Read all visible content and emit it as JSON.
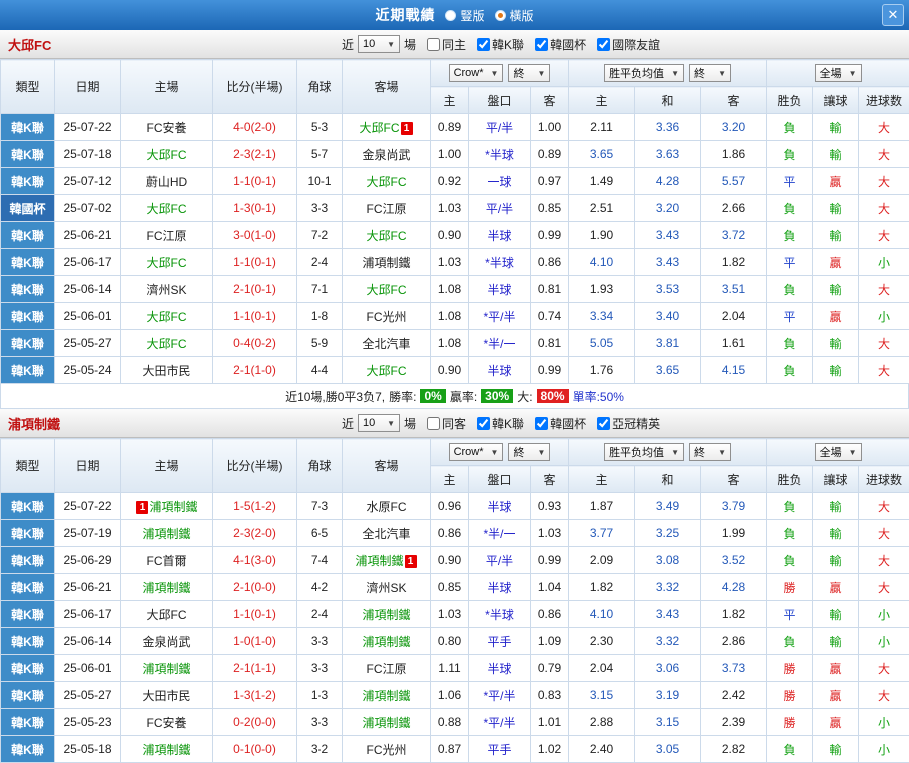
{
  "titlebar": {
    "title": "近期戰績",
    "radios": [
      {
        "label": "豎版",
        "selected": false
      },
      {
        "label": "橫版",
        "selected": true
      }
    ],
    "close_label": "✕"
  },
  "table_header": {
    "left_columns": [
      "類型",
      "日期",
      "主場",
      "比分(半場)",
      "角球",
      "客場"
    ],
    "odds_select": "Crow*",
    "odds_final_select": "終",
    "odds_subcols": [
      "主",
      "盤口",
      "客"
    ],
    "avg_select": "胜平负均值",
    "avg_final_select": "終",
    "avg_subcols": [
      "主",
      "和",
      "客"
    ],
    "full_select": "全場",
    "result_subcols": [
      "胜负",
      "讓球",
      "进球数"
    ]
  },
  "type_colors": {
    "韓K聯": "#3e8cc8",
    "韓國杯": "#2d6db2"
  },
  "value_colors": {
    "勝": "#dd2222",
    "平": "#2244cc",
    "負": "#13a113",
    "贏": "#dd2222",
    "輸": "#13a113",
    "大": "#dd2222",
    "小": "#13a113"
  },
  "sections": [
    {
      "team": "大邱FC",
      "filter": {
        "near_label": "近",
        "count": "10",
        "unit": "場",
        "checkboxes": [
          {
            "label": "同主",
            "checked": false
          },
          {
            "label": "韓K聯",
            "checked": true
          },
          {
            "label": "韓國杯",
            "checked": true
          },
          {
            "label": "國際友誼",
            "checked": true
          }
        ]
      },
      "rows": [
        {
          "type": "韓K聯",
          "date": "25-07-22",
          "home": "FC安養",
          "home_focus": false,
          "score": "4-0(2-0)",
          "corners": "5-3",
          "away": "大邱FC",
          "away_focus": true,
          "away_badge": "1",
          "away_badge_pos": "after",
          "odds": [
            "0.89",
            "平/半",
            "1.00"
          ],
          "avg": [
            "2.11",
            "3.36",
            "3.20"
          ],
          "results": [
            "負",
            "輸",
            "大"
          ]
        },
        {
          "type": "韓K聯",
          "date": "25-07-18",
          "home": "大邱FC",
          "home_focus": true,
          "score": "2-3(2-1)",
          "corners": "5-7",
          "away": "金泉尚武",
          "away_focus": false,
          "odds": [
            "1.00",
            "*半球",
            "0.89"
          ],
          "avg": [
            "3.65",
            "3.63",
            "1.86"
          ],
          "results": [
            "負",
            "輸",
            "大"
          ]
        },
        {
          "type": "韓K聯",
          "date": "25-07-12",
          "home": "蔚山HD",
          "home_focus": false,
          "score": "1-1(0-1)",
          "corners": "10-1",
          "away": "大邱FC",
          "away_focus": true,
          "odds": [
            "0.92",
            "一球",
            "0.97"
          ],
          "avg": [
            "1.49",
            "4.28",
            "5.57"
          ],
          "results": [
            "平",
            "贏",
            "大"
          ]
        },
        {
          "type": "韓國杯",
          "date": "25-07-02",
          "home": "大邱FC",
          "home_focus": true,
          "score": "1-3(0-1)",
          "corners": "3-3",
          "away": "FC江原",
          "away_focus": false,
          "odds": [
            "1.03",
            "平/半",
            "0.85"
          ],
          "avg": [
            "2.51",
            "3.20",
            "2.66"
          ],
          "results": [
            "負",
            "輸",
            "大"
          ]
        },
        {
          "type": "韓K聯",
          "date": "25-06-21",
          "home": "FC江原",
          "home_focus": false,
          "score": "3-0(1-0)",
          "corners": "7-2",
          "away": "大邱FC",
          "away_focus": true,
          "odds": [
            "0.90",
            "半球",
            "0.99"
          ],
          "avg": [
            "1.90",
            "3.43",
            "3.72"
          ],
          "results": [
            "負",
            "輸",
            "大"
          ]
        },
        {
          "type": "韓K聯",
          "date": "25-06-17",
          "home": "大邱FC",
          "home_focus": true,
          "score": "1-1(0-1)",
          "corners": "2-4",
          "away": "浦項制鐵",
          "away_focus": false,
          "odds": [
            "1.03",
            "*半球",
            "0.86"
          ],
          "avg": [
            "4.10",
            "3.43",
            "1.82"
          ],
          "results": [
            "平",
            "贏",
            "小"
          ]
        },
        {
          "type": "韓K聯",
          "date": "25-06-14",
          "home": "濟州SK",
          "home_focus": false,
          "score": "2-1(0-1)",
          "corners": "7-1",
          "away": "大邱FC",
          "away_focus": true,
          "odds": [
            "1.08",
            "半球",
            "0.81"
          ],
          "avg": [
            "1.93",
            "3.53",
            "3.51"
          ],
          "results": [
            "負",
            "輸",
            "大"
          ]
        },
        {
          "type": "韓K聯",
          "date": "25-06-01",
          "home": "大邱FC",
          "home_focus": true,
          "score": "1-1(0-1)",
          "corners": "1-8",
          "away": "FC光州",
          "away_focus": false,
          "odds": [
            "1.08",
            "*平/半",
            "0.74"
          ],
          "avg": [
            "3.34",
            "3.40",
            "2.04"
          ],
          "results": [
            "平",
            "贏",
            "小"
          ]
        },
        {
          "type": "韓K聯",
          "date": "25-05-27",
          "home": "大邱FC",
          "home_focus": true,
          "score": "0-4(0-2)",
          "corners": "5-9",
          "away": "全北汽車",
          "away_focus": false,
          "odds": [
            "1.08",
            "*半/一",
            "0.81"
          ],
          "avg": [
            "5.05",
            "3.81",
            "1.61"
          ],
          "results": [
            "負",
            "輸",
            "大"
          ]
        },
        {
          "type": "韓K聯",
          "date": "25-05-24",
          "home": "大田市民",
          "home_focus": false,
          "score": "2-1(1-0)",
          "corners": "4-4",
          "away": "大邱FC",
          "away_focus": true,
          "odds": [
            "0.90",
            "半球",
            "0.99"
          ],
          "avg": [
            "1.76",
            "3.65",
            "4.15"
          ],
          "results": [
            "負",
            "輸",
            "大"
          ]
        }
      ],
      "summary": {
        "prefix": "近10場,勝0平3负7, ",
        "stats": [
          {
            "label": "勝率: ",
            "value": "0%",
            "bg": "#18a018"
          },
          {
            "label": " 贏率: ",
            "value": "30%",
            "bg": "#18a018"
          },
          {
            "label": " 大: ",
            "value": "80%",
            "bg": "#e02020"
          }
        ],
        "suffix": " 單率:50%"
      }
    },
    {
      "team": "浦項制鐵",
      "filter": {
        "near_label": "近",
        "count": "10",
        "unit": "場",
        "checkboxes": [
          {
            "label": "同客",
            "checked": false
          },
          {
            "label": "韓K聯",
            "checked": true
          },
          {
            "label": "韓國杯",
            "checked": true
          },
          {
            "label": "亞冠精英",
            "checked": true
          }
        ]
      },
      "rows": [
        {
          "type": "韓K聯",
          "date": "25-07-22",
          "home": "浦項制鐵",
          "home_focus": true,
          "home_badge": "1",
          "home_badge_pos": "before",
          "score": "1-5(1-2)",
          "corners": "7-3",
          "away": "水原FC",
          "away_focus": false,
          "odds": [
            "0.96",
            "半球",
            "0.93"
          ],
          "avg": [
            "1.87",
            "3.49",
            "3.79"
          ],
          "results": [
            "負",
            "輸",
            "大"
          ]
        },
        {
          "type": "韓K聯",
          "date": "25-07-19",
          "home": "浦項制鐵",
          "home_focus": true,
          "score": "2-3(2-0)",
          "corners": "6-5",
          "away": "全北汽車",
          "away_focus": false,
          "odds": [
            "0.86",
            "*半/一",
            "1.03"
          ],
          "avg": [
            "3.77",
            "3.25",
            "1.99"
          ],
          "results": [
            "負",
            "輸",
            "大"
          ]
        },
        {
          "type": "韓K聯",
          "date": "25-06-29",
          "home": "FC首爾",
          "home_focus": false,
          "score": "4-1(3-0)",
          "corners": "7-4",
          "away": "浦項制鐵",
          "away_focus": true,
          "away_badge": "1",
          "away_badge_pos": "after",
          "odds": [
            "0.90",
            "平/半",
            "0.99"
          ],
          "avg": [
            "2.09",
            "3.08",
            "3.52"
          ],
          "results": [
            "負",
            "輸",
            "大"
          ]
        },
        {
          "type": "韓K聯",
          "date": "25-06-21",
          "home": "浦項制鐵",
          "home_focus": true,
          "score": "2-1(0-0)",
          "corners": "4-2",
          "away": "濟州SK",
          "away_focus": false,
          "odds": [
            "0.85",
            "半球",
            "1.04"
          ],
          "avg": [
            "1.82",
            "3.32",
            "4.28"
          ],
          "results": [
            "勝",
            "贏",
            "大"
          ]
        },
        {
          "type": "韓K聯",
          "date": "25-06-17",
          "home": "大邱FC",
          "home_focus": false,
          "score": "1-1(0-1)",
          "corners": "2-4",
          "away": "浦項制鐵",
          "away_focus": true,
          "odds": [
            "1.03",
            "*半球",
            "0.86"
          ],
          "avg": [
            "4.10",
            "3.43",
            "1.82"
          ],
          "results": [
            "平",
            "輸",
            "小"
          ]
        },
        {
          "type": "韓K聯",
          "date": "25-06-14",
          "home": "金泉尚武",
          "home_focus": false,
          "score": "1-0(1-0)",
          "corners": "3-3",
          "away": "浦項制鐵",
          "away_focus": true,
          "odds": [
            "0.80",
            "平手",
            "1.09"
          ],
          "avg": [
            "2.30",
            "3.32",
            "2.86"
          ],
          "results": [
            "負",
            "輸",
            "小"
          ]
        },
        {
          "type": "韓K聯",
          "date": "25-06-01",
          "home": "浦項制鐵",
          "home_focus": true,
          "score": "2-1(1-1)",
          "corners": "3-3",
          "away": "FC江原",
          "away_focus": false,
          "odds": [
            "1.11",
            "半球",
            "0.79"
          ],
          "avg": [
            "2.04",
            "3.06",
            "3.73"
          ],
          "results": [
            "勝",
            "贏",
            "大"
          ]
        },
        {
          "type": "韓K聯",
          "date": "25-05-27",
          "home": "大田市民",
          "home_focus": false,
          "score": "1-3(1-2)",
          "corners": "1-3",
          "away": "浦項制鐵",
          "away_focus": true,
          "odds": [
            "1.06",
            "*平/半",
            "0.83"
          ],
          "avg": [
            "3.15",
            "3.19",
            "2.42"
          ],
          "results": [
            "勝",
            "贏",
            "大"
          ]
        },
        {
          "type": "韓K聯",
          "date": "25-05-23",
          "home": "FC安養",
          "home_focus": false,
          "score": "0-2(0-0)",
          "corners": "3-3",
          "away": "浦項制鐵",
          "away_focus": true,
          "odds": [
            "0.88",
            "*平/半",
            "1.01"
          ],
          "avg": [
            "2.88",
            "3.15",
            "2.39"
          ],
          "results": [
            "勝",
            "贏",
            "小"
          ]
        },
        {
          "type": "韓K聯",
          "date": "25-05-18",
          "home": "浦項制鐵",
          "home_focus": true,
          "score": "0-1(0-0)",
          "corners": "3-2",
          "away": "FC光州",
          "away_focus": false,
          "odds": [
            "0.87",
            "平手",
            "1.02"
          ],
          "avg": [
            "2.40",
            "3.05",
            "2.82"
          ],
          "results": [
            "負",
            "輸",
            "小"
          ]
        }
      ]
    }
  ]
}
